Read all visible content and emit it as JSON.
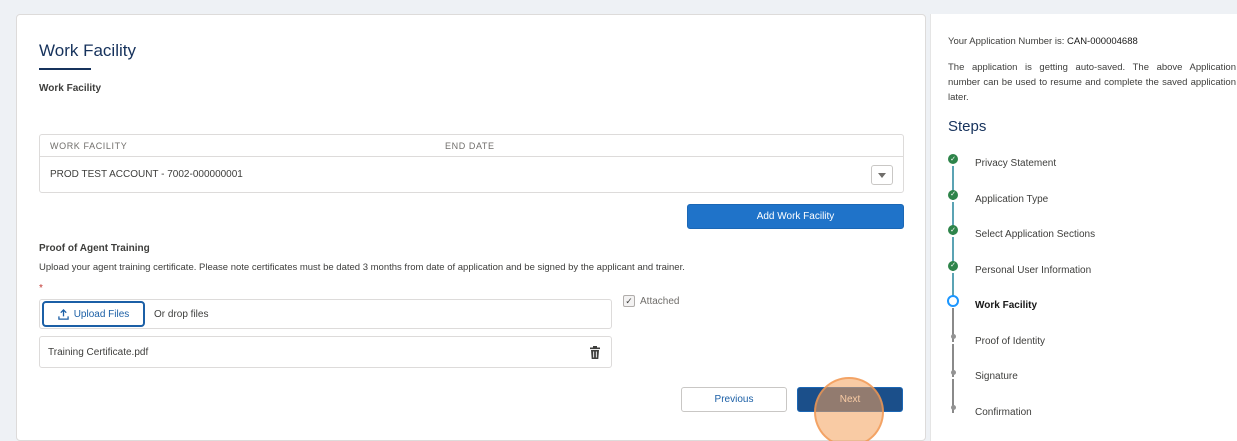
{
  "form": {
    "title": "Work Facility",
    "subtitle": "Work Facility",
    "table": {
      "columns": [
        "WORK FACILITY",
        "END DATE"
      ],
      "rows": [
        {
          "facility": "PROD TEST ACCOUNT - 7002-000000001",
          "end_date": ""
        }
      ]
    },
    "add_button": "Add Work Facility",
    "proof": {
      "title": "Proof of Agent Training",
      "description": "Upload your agent training certificate. Please note certificates must be dated 3 months from date of application and be signed by the applicant and trainer.",
      "required_mark": "*",
      "upload_label": "Upload Files",
      "drop_text": "Or drop files",
      "attached_label": "Attached",
      "attached_checked": true,
      "file_name": "Training Certificate.pdf"
    },
    "previous_label": "Previous",
    "next_label": "Next"
  },
  "sidebar": {
    "app_number_label": "Your Application Number is:",
    "app_number": "CAN-000004688",
    "autosave_note": "The application is getting auto-saved. The above Application number can be used to resume and complete the saved application later.",
    "steps_title": "Steps",
    "steps": [
      {
        "label": "Privacy Statement",
        "status": "complete"
      },
      {
        "label": "Application Type",
        "status": "complete"
      },
      {
        "label": "Select Application Sections",
        "status": "complete"
      },
      {
        "label": "Personal User Information",
        "status": "complete"
      },
      {
        "label": "Work Facility",
        "status": "current"
      },
      {
        "label": "Proof of Identity",
        "status": "upcoming"
      },
      {
        "label": "Signature",
        "status": "upcoming"
      },
      {
        "label": "Confirmation",
        "status": "upcoming"
      }
    ]
  },
  "colors": {
    "primary": "#1f73c9",
    "complete": "#2e844a",
    "current": "#1b96ff",
    "upcoming": "#939393",
    "heading": "#16325c"
  }
}
